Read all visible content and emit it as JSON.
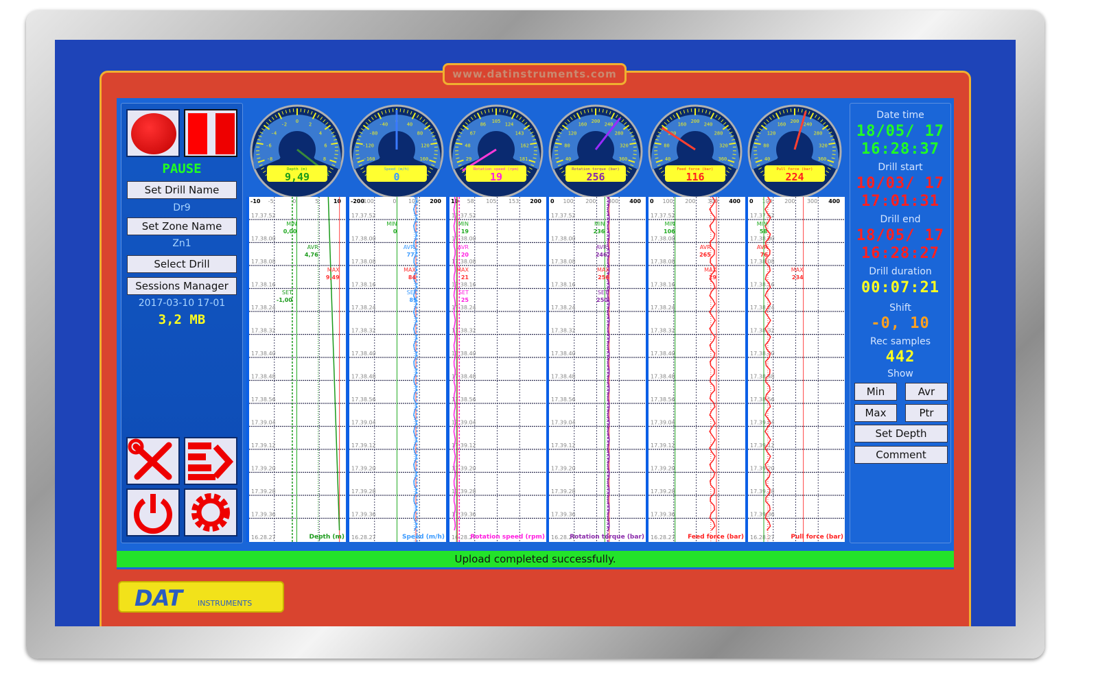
{
  "website": "www.datinstruments.com",
  "left": {
    "state": "PAUSE",
    "set_drill_name": "Set Drill Name",
    "drill_name": "Dr9",
    "set_zone_name": "Set Zone Name",
    "zone_name": "Zn1",
    "select_drill": "Select Drill",
    "sessions_manager": "Sessions Manager",
    "session_date": "2017-03-10 17-01",
    "size": "3,2 MB"
  },
  "right": {
    "date_time_label": "Date time",
    "date": "18/05/ 17",
    "time": "16:28:37",
    "drill_start_label": "Drill start",
    "start_date": "10/03/ 17",
    "start_time": "17:01:31",
    "drill_end_label": "Drill end",
    "end_date": "18/05/ 17",
    "end_time": "16:28:27",
    "duration_label": "Drill duration",
    "duration": "00:07:21",
    "shift_label": "Shift",
    "shift": "-0, 10",
    "rec_label": "Rec samples",
    "rec": "442",
    "show_label": "Show",
    "min": "Min",
    "avr": "Avr",
    "max": "Max",
    "ptr": "Ptr",
    "set_depth": "Set Depth",
    "comment": "Comment"
  },
  "status": "Upload completed successfully.",
  "logo": {
    "brand": "DAT",
    "sub": "INSTRUMENTS"
  },
  "colors": {
    "frame_blue": "#1e44b8",
    "red": "#d9442f",
    "screen": "#1a66d8",
    "status_green": "#23e32a"
  },
  "time_labels": [
    "17.37.52",
    "17.38.00",
    "17.38.08",
    "17.38.16",
    "17.38.24",
    "17.38.32",
    "17.38.40",
    "17.38.48",
    "17.38.56",
    "17.39.04",
    "17.39.12",
    "17.39.20",
    "17.39.28",
    "17.39.36"
  ],
  "bottom_time": "16.28.27",
  "channels": [
    {
      "title": "Depth (m)",
      "value": "9,49",
      "num": 9.49,
      "range": [
        -10,
        10
      ],
      "gauge_ticks": [
        "-10",
        "-8",
        "-6",
        "-4",
        "-2",
        "0",
        "2",
        "4",
        "6",
        "8",
        "10"
      ],
      "axis": [
        "-10",
        "-5",
        "0",
        "5",
        "10"
      ],
      "color": "#1a9a1a",
      "needle": "#3a8a3a",
      "min": "0,00",
      "minv": 0,
      "avr": "4,76",
      "avrv": 4.76,
      "max": "9,49",
      "maxv": 9.49,
      "set": "-1,00",
      "setv": -1,
      "trace": [
        7,
        9.49
      ]
    },
    {
      "title": "Speed (m/h)",
      "value": "0",
      "num": 0,
      "range": [
        -200,
        200
      ],
      "gauge_ticks": [
        "-200",
        "-160",
        "-120",
        "-80",
        "-40",
        "0",
        "40",
        "80",
        "120",
        "160",
        "200"
      ],
      "axis": [
        "-200",
        "-100",
        "0",
        "100",
        "200"
      ],
      "color": "#3a9aff",
      "needle": "#3a7aff",
      "min": "0",
      "minv": 0,
      "avr": "77",
      "avrv": 77,
      "max": "84",
      "maxv": 84,
      "set": "89",
      "setv": 89,
      "trace": [
        80,
        80
      ]
    },
    {
      "title": "Rotation speed (rpm)",
      "value": "19",
      "num": 19,
      "range": [
        10,
        200
      ],
      "gauge_ticks": [
        "10",
        "29",
        "48",
        "67",
        "86",
        "105",
        "124",
        "143",
        "162",
        "181",
        "200"
      ],
      "axis": [
        "10",
        "58",
        "105",
        "153",
        "200"
      ],
      "color": "#ff1ee0",
      "needle": "#ff3ad8",
      "min": "19",
      "minv": 19,
      "avr": "20",
      "avrv": 20,
      "max": "21",
      "maxv": 21,
      "set": "25",
      "setv": 25,
      "trace": [
        15,
        15
      ]
    },
    {
      "title": "Rotation torque (bar)",
      "value": "256",
      "num": 256,
      "range": [
        0,
        400
      ],
      "gauge_ticks": [
        "0",
        "40",
        "80",
        "120",
        "160",
        "200",
        "240",
        "280",
        "320",
        "360",
        "400"
      ],
      "axis": [
        "0",
        "100",
        "200",
        "300",
        "400"
      ],
      "color": "#8a2aaa",
      "needle": "#9a2aff",
      "min": "236",
      "minv": 236,
      "avr": "246",
      "avrv": 246,
      "max": "256",
      "maxv": 256,
      "set": "250",
      "setv": 250,
      "trace": [
        253,
        253
      ]
    },
    {
      "title": "Feed force (bar)",
      "value": "116",
      "num": 116,
      "range": [
        0,
        400
      ],
      "gauge_ticks": [
        "0",
        "40",
        "80",
        "120",
        "160",
        "200",
        "240",
        "280",
        "320",
        "360",
        "400"
      ],
      "axis": [
        "0",
        "100",
        "200",
        "300",
        "400"
      ],
      "color": "#ff2020",
      "needle": "#ff4030",
      "min": "106",
      "minv": 106,
      "avr": "265",
      "avrv": 265,
      "max": "29",
      "maxv": 290,
      "set": "",
      "setv": null,
      "trace": [
        272,
        272
      ]
    },
    {
      "title": "Pull force (bar)",
      "value": "224",
      "num": 224,
      "range": [
        0,
        400
      ],
      "gauge_ticks": [
        "0",
        "40",
        "80",
        "120",
        "160",
        "200",
        "240",
        "280",
        "320",
        "360",
        "400"
      ],
      "axis": [
        "0",
        "100",
        "200",
        "300",
        "400"
      ],
      "color": "#ff2020",
      "needle": "#ff4030",
      "min": "58",
      "minv": 58,
      "avr": "76",
      "avrv": 76,
      "max": "234",
      "maxv": 234,
      "set": "",
      "setv": null,
      "trace": [
        76,
        76
      ]
    }
  ]
}
